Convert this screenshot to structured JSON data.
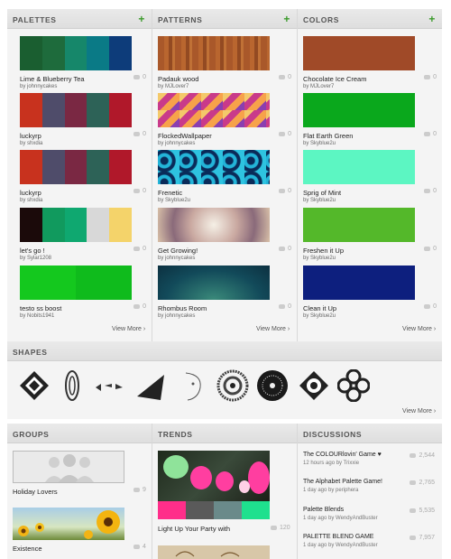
{
  "sections": {
    "palettes": {
      "title": "PALETTES",
      "add": "+"
    },
    "patterns": {
      "title": "PATTERNS",
      "add": "+"
    },
    "colors": {
      "title": "COLORS",
      "add": "+"
    },
    "shapes": {
      "title": "SHAPES"
    },
    "groups": {
      "title": "GROUPS"
    },
    "trends": {
      "title": "TRENDS"
    },
    "discussions": {
      "title": "DISCUSSIONS"
    }
  },
  "palettes": [
    {
      "title": "Lime & Blueberry Tea",
      "by": "by johnnycakes",
      "count": "0",
      "colors": [
        "#1a5e30",
        "#1e6b3c",
        "#16876a",
        "#0a7a86",
        "#0d3c7a"
      ]
    },
    {
      "title": "luckyrp",
      "by": "by shxdia",
      "count": "0",
      "colors": [
        "#c8321e",
        "#4f4c6a",
        "#7a2843",
        "#2d6257",
        "#b0182a"
      ]
    },
    {
      "title": "luckyrp",
      "by": "by shxdia",
      "count": "0",
      "colors": [
        "#c8321e",
        "#4f4c6a",
        "#7a2843",
        "#2d6257",
        "#b0182a"
      ]
    },
    {
      "title": "let's go !",
      "by": "by Sylar1208",
      "count": "0",
      "colors": [
        "#1b0a0a",
        "#119a5e",
        "#0fa870",
        "#d8d8d8",
        "#f4d36a"
      ]
    },
    {
      "title": "testo ss boost",
      "by": "by Nobits1941",
      "count": "0",
      "colors": [
        "#14c81e",
        "#0fbb1c"
      ]
    }
  ],
  "patterns": [
    {
      "title": "Padauk wood",
      "by": "by MJLover7",
      "count": "0"
    },
    {
      "title": "FlockedWallpaper",
      "by": "by johnnycakes",
      "count": "0"
    },
    {
      "title": "Frenetic",
      "by": "by Skyblue2u",
      "count": "0"
    },
    {
      "title": "Get Growing!",
      "by": "by johnnycakes",
      "count": "0"
    },
    {
      "title": "Rhombus Room",
      "by": "by johnnycakes",
      "count": "0"
    }
  ],
  "colors": [
    {
      "title": "Chocolate Ice Cream",
      "by": "by MJLover7",
      "count": "0",
      "color": "#a04a28"
    },
    {
      "title": "Flat Earth Green",
      "by": "by Skyblue2u",
      "count": "0",
      "color": "#0aa81c"
    },
    {
      "title": "Sprig of Mint",
      "by": "by Skyblue2u",
      "count": "0",
      "color": "#5cf6c2"
    },
    {
      "title": "Freshen it Up",
      "by": "by Skyblue2u",
      "count": "0",
      "color": "#54b82a"
    },
    {
      "title": "Clean it Up",
      "by": "by Skyblue2u",
      "count": "0",
      "color": "#0d1f7e"
    }
  ],
  "view_more": "View More ›",
  "groups": [
    {
      "title": "Holiday Lovers",
      "count": "9"
    },
    {
      "title": "Existence",
      "count": "4"
    }
  ],
  "trends": [
    {
      "title": "Light Up Your Party with",
      "count": "120",
      "colors": [
        "#ff2e8a",
        "#5a5a5a",
        "#6a8a8a",
        "#1fe08e"
      ]
    }
  ],
  "discussions": [
    {
      "title": "The COLOURlovin' Game ♥",
      "sub": "12 hours ago by Trixxie",
      "count": "2,544"
    },
    {
      "title": "The Alphabet Palette Game!",
      "sub": "1 day ago by periphera",
      "count": "2,765"
    },
    {
      "title": "Palette Blends",
      "sub": "1 day ago by WendyAndBuster",
      "count": "5,535"
    },
    {
      "title": "PALETTE BLEND GAME",
      "sub": "1 day ago by WendyAndBuster",
      "count": "7,957"
    }
  ]
}
